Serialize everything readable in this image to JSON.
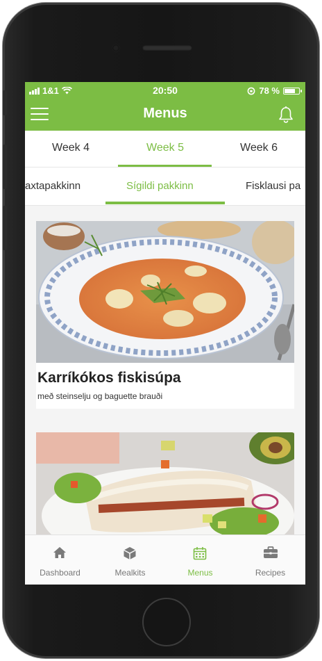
{
  "status": {
    "carrier": "1&1",
    "time": "20:50",
    "battery_text": "78 %",
    "battery_level": 0.78
  },
  "header": {
    "title": "Menus",
    "menu_icon": "hamburger-icon",
    "bell_icon": "bell-icon"
  },
  "weeks": {
    "items": [
      "Week 4",
      "Week 5",
      "Week 6"
    ],
    "active_index": 1
  },
  "packages": {
    "items": [
      "axtapakkinn",
      "Sígildi pakkinn",
      "Fisklausi pa"
    ],
    "active_index": 1
  },
  "recipes": [
    {
      "title": "Karríkókos fiskisúpa",
      "subtitle": "með steinselju og baguette brauði"
    }
  ],
  "tabbar": {
    "items": [
      {
        "label": "Dashboard",
        "icon": "home-icon"
      },
      {
        "label": "Mealkits",
        "icon": "box-icon"
      },
      {
        "label": "Menus",
        "icon": "calendar-icon"
      },
      {
        "label": "Recipes",
        "icon": "briefcase-icon"
      }
    ],
    "active_index": 2
  },
  "colors": {
    "brand": "#7cbd44",
    "text": "#333333",
    "inactive_tab": "#777777"
  }
}
